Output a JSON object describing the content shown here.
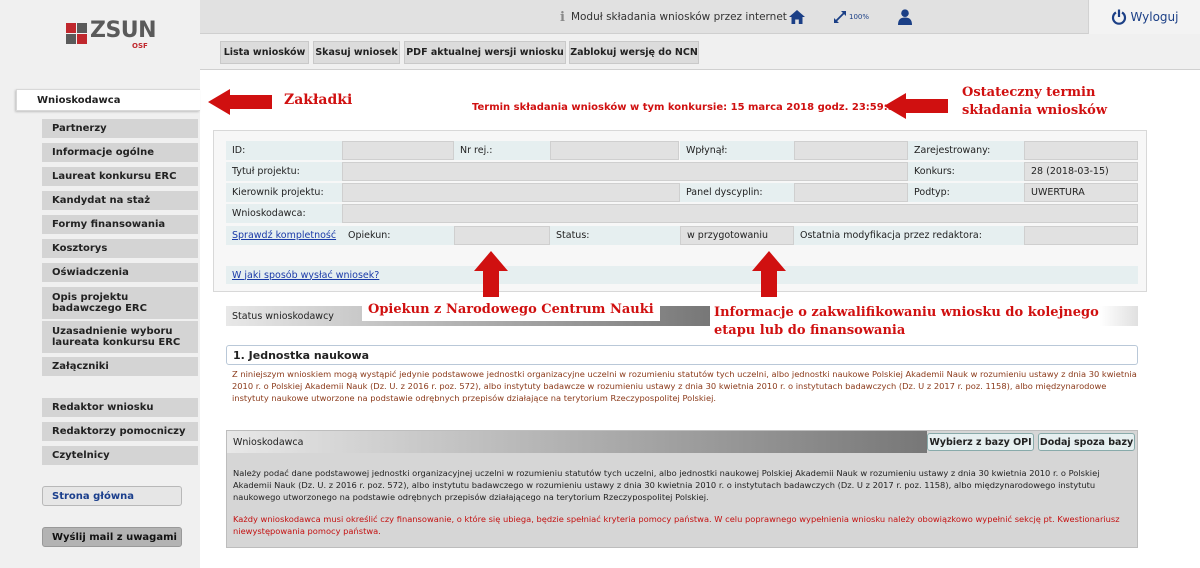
{
  "app": {
    "logo_text": "ZSUN",
    "logo_sub": "OSF",
    "colors": {
      "accent": "#1b3f86",
      "annotation_red": "#d01010",
      "logo_red": "#c0272d"
    }
  },
  "topbar": {
    "module_label": "Moduł składania wniosków przez internet",
    "zoom_label": "100%",
    "logout_label": "Wyloguj",
    "icons": [
      "info-icon",
      "home-icon",
      "zoom-icon",
      "user-icon",
      "power-icon"
    ]
  },
  "toolbar": {
    "buttons": [
      {
        "label": "Lista wniosków"
      },
      {
        "label": "Skasuj wniosek"
      },
      {
        "label": "PDF aktualnej wersji wniosku"
      },
      {
        "label": "Zablokuj wersję do NCN"
      }
    ]
  },
  "sidebar": {
    "items": [
      {
        "label": "Wnioskodawca",
        "active": true
      },
      {
        "label": "Partnerzy"
      },
      {
        "label": "Informacje ogólne"
      },
      {
        "label": "Laureat konkursu ERC"
      },
      {
        "label": "Kandydat na staż"
      },
      {
        "label": "Formy finansowania"
      },
      {
        "label": "Kosztorys"
      },
      {
        "label": "Oświadczenia"
      },
      {
        "label": "Opis projektu badawczego ERC"
      },
      {
        "label": "Uzasadnienie wyboru laureata konkursu ERC"
      },
      {
        "label": "Załączniki"
      },
      {
        "label": "Redaktor wniosku"
      },
      {
        "label": "Redaktorzy pomocniczy"
      },
      {
        "label": "Czytelnicy"
      }
    ],
    "home_label": "Strona główna",
    "mail_label": "Wyślij mail z uwagami"
  },
  "main": {
    "deadline_text": "Termin składania wniosków w tym konkursie: 15 marca 2018 godz. 23:59:59",
    "form": {
      "id_label": "ID:",
      "id_value": "",
      "nrrej_label": "Nr rej.:",
      "nrrej_value": "",
      "wplynal_label": "Wpłynął:",
      "wplynal_value": "",
      "zarejestrowany_label": "Zarejestrowany:",
      "zarejestrowany_value": "",
      "tytul_label": "Tytuł projektu:",
      "tytul_value": "",
      "konkurs_label": "Konkurs:",
      "konkurs_value": "28 (2018-03-15)",
      "kierownik_label": "Kierownik projektu:",
      "kierownik_value": "",
      "panel_label": "Panel dyscyplin:",
      "panel_value": "",
      "podtyp_label": "Podtyp:",
      "podtyp_value": "UWERTURA",
      "wnioskodawca_label": "Wnioskodawca:",
      "wnioskodawca_value": "",
      "sprawdz_label": "Sprawdź kompletność",
      "opiekun_label": "Opiekun:",
      "opiekun_value": "",
      "status_label": "Status:",
      "status_value": "w przygotowaniu",
      "modyfikacja_label": "Ostatnia modyfikacja przez redaktora:",
      "modyfikacja_value": ""
    },
    "how_send_link": "W jaki sposób wysłać wniosek?",
    "status_bar_label": "Status wnioskodawcy",
    "section1": {
      "title": "1. Jednostka naukowa",
      "text": "Z niniejszym wnioskiem mogą wystąpić jedynie podstawowe jednostki organizacyjne uczelni w rozumieniu statutów tych uczelni, albo jednostki naukowe Polskiej Akademii Nauk w rozumieniu ustawy z dnia 30 kwietnia 2010 r. o Polskiej Akademii Nauk (Dz. U. z 2016 r. poz. 572), albo instytuty badawcze w rozumieniu ustawy z dnia 30 kwietnia 2010 r. o instytutach badawczych (Dz. U z 2017 r. poz. 1158), albo międzynarodowe instytuty naukowe utworzone na podstawie odrębnych przepisów działające na terytorium Rzeczypospolitej Polskiej."
    },
    "section2": {
      "title": "Wnioskodawca",
      "btn_opi": "Wybierz z bazy OPI",
      "btn_add": "Dodaj spoza bazy",
      "text": "Należy podać dane podstawowej jednostki organizacyjnej uczelni w rozumieniu statutów tych uczelni, albo jednostki naukowej Polskiej Akademii Nauk w rozumieniu ustawy z dnia 30 kwietnia 2010 r. o Polskiej Akademii Nauk (Dz. U. z 2016 r. poz. 572), albo instytutu badawczego w rozumieniu ustawy z dnia 30 kwietnia 2010 r. o instytutach badawczych (Dz. U z 2017 r. poz. 1158), albo międzynarodowego instytutu naukowego utworzonego na podstawie odrębnych przepisów działającego na terytorium Rzeczypospolitej Polskiej.",
      "warning": "Każdy wnioskodawca musi określić czy finansowanie, o które się ubiega, będzie spełniać kryteria pomocy państwa. W celu poprawnego wypełnienia wniosku należy obowiązkowo wypełnić sekcję pt. Kwestionariusz niewystępowania pomocy państwa."
    }
  },
  "annotations": {
    "zakladki": "Zakładki",
    "termin_line1": "Ostateczny termin",
    "termin_line2": "składania wniosków",
    "opiekun": "Opiekun z Narodowego Centrum Nauki",
    "informacje_line1": "Informacje o zakwalifikowaniu wniosku do kolejnego",
    "informacje_line2": "etapu lub do finansowania"
  }
}
